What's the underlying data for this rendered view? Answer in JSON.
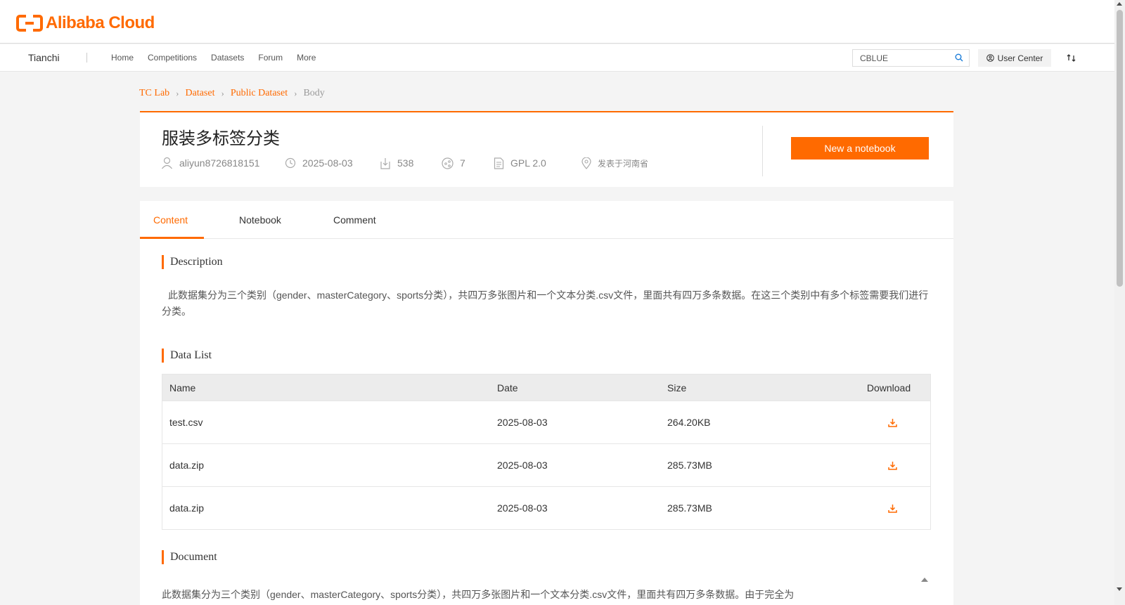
{
  "brand": {
    "logo_text": "Alibaba Cloud"
  },
  "nav": {
    "brand": "Tianchi",
    "links": [
      "Home",
      "Competitions",
      "Datasets",
      "Forum",
      "More"
    ],
    "search_value": "CBLUE",
    "user_center": "User Center"
  },
  "breadcrumb": {
    "items": [
      "TC Lab",
      "Dataset",
      "Public Dataset"
    ],
    "current": "Body"
  },
  "dataset": {
    "title": "服装多标签分类",
    "author": "aliyun8726818151",
    "date": "2025-08-03",
    "downloads": "538",
    "shares": "7",
    "license": "GPL 2.0",
    "location": "发表于河南省",
    "new_notebook": "New a notebook"
  },
  "tabs": [
    "Content",
    "Notebook",
    "Comment"
  ],
  "description": {
    "title": "Description",
    "text": "此数据集分为三个类别（gender、masterCategory、sports分类），共四万多张图片和一个文本分类.csv文件，里面共有四万多条数据。在这三个类别中有多个标签需要我们进行分类。"
  },
  "data_list": {
    "title": "Data List",
    "columns": [
      "Name",
      "Date",
      "Size",
      "Download"
    ],
    "rows": [
      {
        "name": "test.csv",
        "date": "2025-08-03",
        "size": "264.20KB"
      },
      {
        "name": "data.zip",
        "date": "2025-08-03",
        "size": "285.73MB"
      },
      {
        "name": "data.zip",
        "date": "2025-08-03",
        "size": "285.73MB"
      }
    ]
  },
  "document": {
    "title": "Document",
    "peek": "此数据集分为三个类别（gender、masterCategory、sports分类），共四万多张图片和一个文本分类.csv文件，里面共有四万多条数据。由于完全为"
  },
  "colors": {
    "accent": "#ff6a00",
    "background": "#f4f4f4"
  }
}
